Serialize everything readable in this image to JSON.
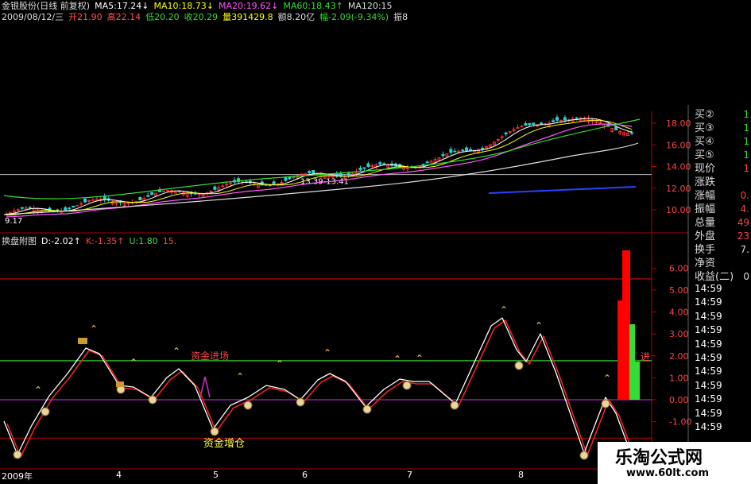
{
  "header": {
    "line1": [
      {
        "text": "金银股份(日线 前复权)",
        "color": "#dddddd"
      },
      {
        "text": "MA5:17.24↓",
        "color": "#ffffff"
      },
      {
        "text": "MA10:18.73↓",
        "color": "#ffff00"
      },
      {
        "text": "MA20:19.62↓",
        "color": "#ff55ff"
      },
      {
        "text": "MA60:18.43↑",
        "color": "#33dd33"
      },
      {
        "text": "MA120:15",
        "color": "#dddddd"
      }
    ],
    "line2": [
      {
        "text": "2009/08/12/三",
        "color": "#dddddd"
      },
      {
        "text": "开21.90",
        "color": "#ff5555"
      },
      {
        "text": "高22.14",
        "color": "#ff5555"
      },
      {
        "text": "低20.20",
        "color": "#33dd33"
      },
      {
        "text": "收20.29",
        "color": "#33dd33"
      },
      {
        "text": "量391429.8",
        "color": "#ffff00"
      },
      {
        "text": "额8.20亿",
        "color": "#dddddd"
      },
      {
        "text": "幅-2.09(-9.34%)",
        "color": "#33dd33"
      },
      {
        "text": "振8",
        "color": "#dddddd"
      }
    ]
  },
  "sub_header": [
    {
      "text": "换盘附图",
      "color": "#dddddd"
    },
    {
      "text": "D:-2.02↑",
      "color": "#ffffff"
    },
    {
      "text": "K:-1.35↑",
      "color": "#ff4444"
    },
    {
      "text": "U:1.80",
      "color": "#44dd44"
    },
    {
      "text": "15.",
      "color": "#ff4444"
    }
  ],
  "price_axis": [
    "18.00",
    "16.00",
    "14.00",
    "12.00",
    "10.00"
  ],
  "indicator_axis": [
    "6.00",
    "5.00",
    "4.00",
    "3.00",
    "2.00",
    "1.00",
    "0.00",
    "-1.00"
  ],
  "price_annotations": {
    "mid": "13.39-13.41",
    "low": "9.17"
  },
  "indicator_annotations": {
    "inflow": "资金进场",
    "increase": "资金增仓",
    "jin": "进"
  },
  "quote_panel": [
    {
      "label": "买②",
      "value": "1"
    },
    {
      "label": "买③",
      "value": "1"
    },
    {
      "label": "买④",
      "value": "1"
    },
    {
      "label": "买⑤",
      "value": "1"
    },
    {
      "label": "现价",
      "value": "1"
    },
    {
      "label": "涨跌",
      "value": ""
    },
    {
      "label": "涨幅",
      "value": "0."
    },
    {
      "label": "振幅",
      "value": "4."
    },
    {
      "label": "总量",
      "value": "49"
    },
    {
      "label": "外盘",
      "value": "23"
    }
  ],
  "quote_panel2": [
    {
      "label": "换手",
      "value": "7."
    },
    {
      "label": "净资",
      "value": ""
    },
    {
      "label": "收益(二)",
      "value": "0"
    }
  ],
  "time_list": [
    "14:59",
    "14:59",
    "14:59",
    "14:59",
    "14:59",
    "14:59",
    "14:59",
    "14:59",
    "14:59",
    "14:59",
    "14:59"
  ],
  "date_axis": [
    "2009年",
    "4",
    "5",
    "6",
    "7",
    "8"
  ],
  "watermark": {
    "title": "乐淘公式网",
    "url": "www.60lt.com"
  },
  "colors": {
    "up": "#ff3333",
    "down": "#33cccc",
    "ma5": "#ffffff",
    "ma10": "#ffff00",
    "ma20": "#ff55ff",
    "ma60": "#33dd33",
    "ma120": "#dddddd",
    "grid": "#aa0000"
  }
}
